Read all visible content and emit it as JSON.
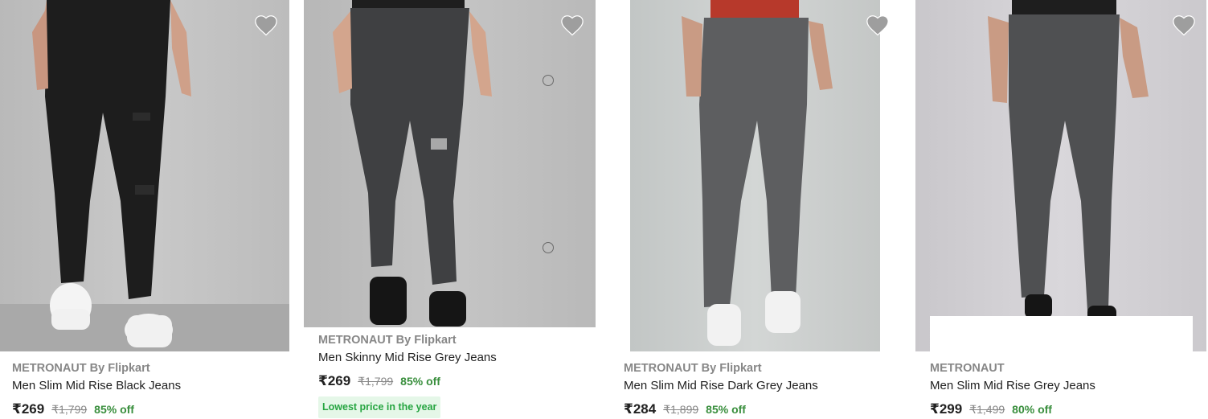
{
  "products": [
    {
      "brand": "METRONAUT By Flipkart",
      "title": "Men Slim Mid Rise Black Jeans",
      "price": "₹269",
      "mrp": "₹1,799",
      "discount": "85% off",
      "jeans_color": "#1d1d1d"
    },
    {
      "brand": "METRONAUT By Flipkart",
      "title": "Men Skinny Mid Rise Grey Jeans",
      "price": "₹269",
      "mrp": "₹1,799",
      "discount": "85% off",
      "tag": "Lowest price in the year",
      "jeans_color": "#3f4042"
    },
    {
      "brand": "METRONAUT By Flipkart",
      "title": "Men Slim Mid Rise Dark Grey Jeans",
      "price": "₹284",
      "mrp": "₹1,899",
      "discount": "85% off",
      "jeans_color": "#5d5e60"
    },
    {
      "brand": "METRONAUT",
      "title": "Men Slim Mid Rise Grey Jeans",
      "price": "₹299",
      "mrp": "₹1,499",
      "discount": "80% off",
      "jeans_color": "#4f5052"
    }
  ],
  "icons": {
    "wishlist": "heart-icon"
  },
  "colors": {
    "discount": "#388e3c",
    "tag_text": "#26a541",
    "tag_bg": "#e5f7e8",
    "brand_text": "#878787",
    "wishlist": "#9e9e9e"
  }
}
